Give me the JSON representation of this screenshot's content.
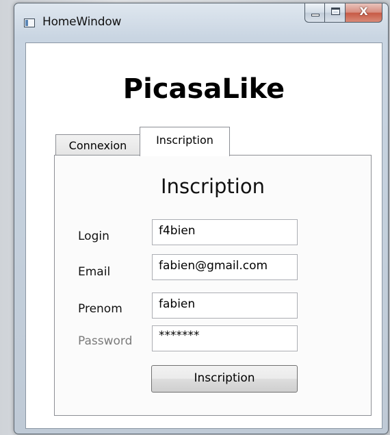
{
  "window": {
    "title": "HomeWindow",
    "icon": "app-window-icon",
    "controls": {
      "minimize_icon": "minimize-icon",
      "maximize_icon": "maximize-icon",
      "close_label": "X"
    }
  },
  "app": {
    "title": "PicasaLike"
  },
  "tabs": [
    {
      "label": "Connexion",
      "selected": false
    },
    {
      "label": "Inscription",
      "selected": true
    }
  ],
  "form": {
    "heading": "Inscription",
    "fields": {
      "login": {
        "label": "Login",
        "value": "f4bien"
      },
      "email": {
        "label": "Email",
        "value": "fabien@gmail.com"
      },
      "prenom": {
        "label": "Prenom",
        "value": "fabien"
      },
      "password": {
        "label": "Password",
        "value": "*******"
      }
    },
    "submit_label": "Inscription"
  }
}
